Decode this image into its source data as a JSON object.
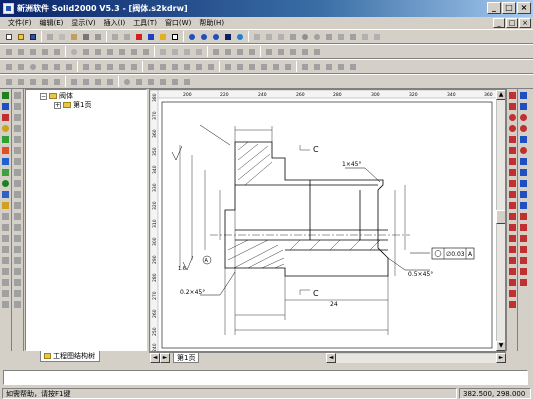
{
  "window": {
    "title": "新洲软件 Solid2000 V5.3 - [阀体.s2kdrw]",
    "min_label": "_",
    "max_label": "□",
    "close_label": "×"
  },
  "menu": {
    "items": [
      "文件(F)",
      "编辑(E)",
      "显示(V)",
      "插入(I)",
      "工具(T)",
      "窗口(W)",
      "帮助(H)"
    ],
    "mdi_buttons": [
      "_",
      "□",
      "×"
    ]
  },
  "tree": {
    "root_label": "阀体",
    "child_label": "第1页",
    "tab_label": "工程图结构树"
  },
  "drawing": {
    "top_ruler": [
      "200",
      "220",
      "240",
      "260",
      "280",
      "300",
      "320",
      "340",
      "360"
    ],
    "left_ruler": [
      "380",
      "370",
      "360",
      "350",
      "340",
      "330",
      "320",
      "310",
      "300",
      "290",
      "280",
      "270",
      "260",
      "250",
      "240"
    ],
    "dims": {
      "d1": "1×45°",
      "d2": "0.5×45°",
      "d3": "0.2×45°",
      "d4": "C",
      "d5": "C",
      "d6": "∅0.03",
      "d7": "A",
      "d8": "A",
      "d9": "24",
      "d10": "1.6"
    }
  },
  "page_tab": "第1页",
  "status": {
    "help": "如需帮助，请按F1键",
    "coords": "382.500, 298.000"
  }
}
